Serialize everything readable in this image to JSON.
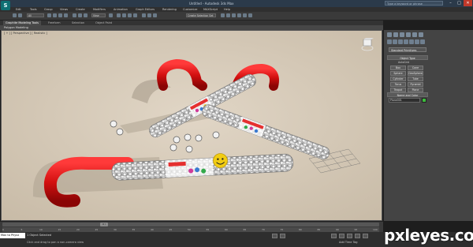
{
  "window": {
    "title": "Untitled - Autodesk 3ds Max",
    "search_placeholder": "Type a keyword or phrase",
    "minimize": "–",
    "maximize": "□",
    "close": "✕"
  },
  "menu": {
    "items": [
      "Edit",
      "Tools",
      "Group",
      "Views",
      "Create",
      "Modifiers",
      "Animation",
      "Graph Editors",
      "Rendering",
      "Customize",
      "MAXScript",
      "Help"
    ]
  },
  "toolbar": {
    "selection_filter": "All",
    "ref_coord": "View",
    "named_set": "Create Selection Set"
  },
  "ribbon": {
    "tabs": [
      "Graphite Modeling Tools",
      "Freeform",
      "Selection",
      "Object Paint"
    ],
    "subtitle": "Polygon Modeling"
  },
  "viewport": {
    "label": "[ + ] [ Perspective ] [ Realistic ]"
  },
  "command_panel": {
    "category": "Standard Primitives",
    "object_type_header": "Object Type",
    "autogrid": "AutoGrid",
    "buttons": [
      "Box",
      "Cone",
      "Sphere",
      "GeoSphere",
      "Cylinder",
      "Tube",
      "Torus",
      "Pyramid",
      "Teapot",
      "Plane"
    ],
    "name_color_header": "Name and Color",
    "name_value": "Plane001",
    "swatch_color": "#3dbb3d"
  },
  "timeline": {
    "frame_display": "0 / 100",
    "ticks": [
      "0",
      "5",
      "10",
      "15",
      "20",
      "25",
      "30",
      "35",
      "40",
      "45",
      "50",
      "55",
      "60",
      "65",
      "70",
      "75",
      "80",
      "85",
      "90",
      "95",
      "100"
    ]
  },
  "status": {
    "maxscript": "Max to Physx",
    "selected": "1 Object Selected",
    "hint": "Click and drag to pan a non-camera view",
    "add_time_tag": "Add Time Tag"
  },
  "watermark": "pxleyes.com",
  "colors": {
    "viewport_bg": "#d2c6b5",
    "cane_red": "#d81414",
    "accent_teal": "#0e6f73"
  }
}
